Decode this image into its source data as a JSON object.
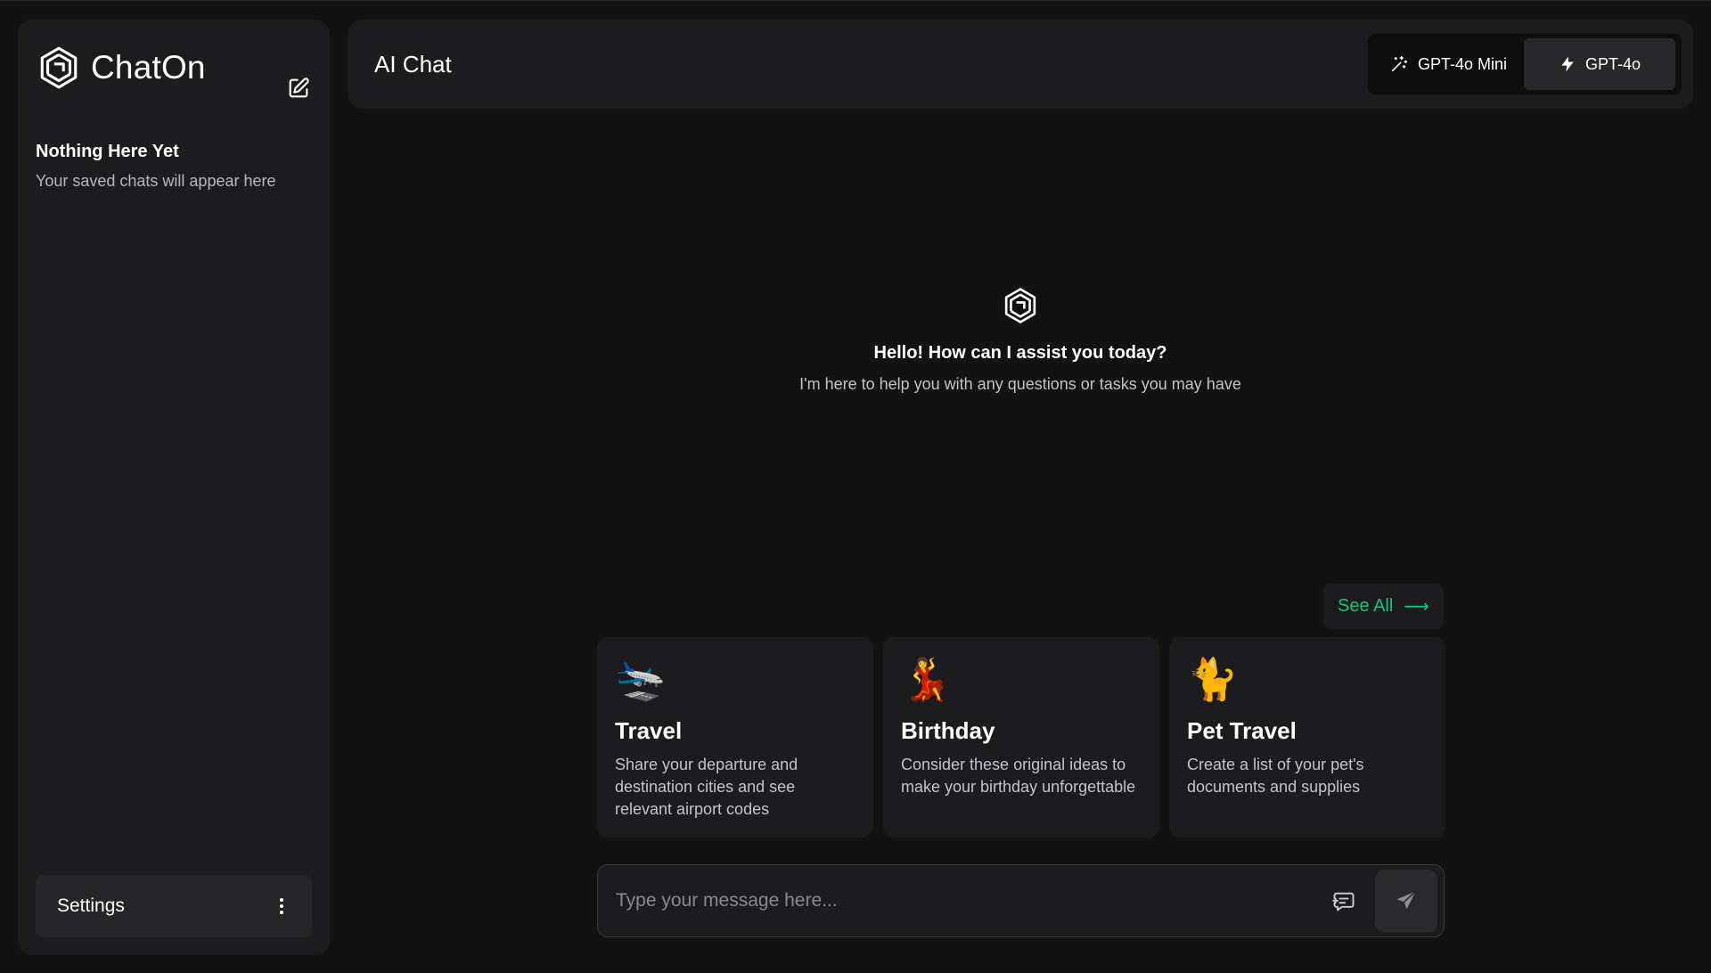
{
  "sidebar": {
    "brand": "ChatOn",
    "empty_title": "Nothing Here Yet",
    "empty_subtitle": "Your saved chats will appear here",
    "settings_label": "Settings"
  },
  "header": {
    "title": "AI Chat",
    "models": [
      {
        "label": "GPT-4o Mini",
        "icon": "magic-wand-icon",
        "selected": false
      },
      {
        "label": "GPT-4o",
        "icon": "lightning-bolt-icon",
        "selected": true
      }
    ]
  },
  "greeting": {
    "title": "Hello! How can I assist you today?",
    "subtitle": "I'm here to help you with any questions or tasks you may have"
  },
  "suggestions": {
    "see_all_label": "See All",
    "see_all_arrow": "⟶",
    "cards": [
      {
        "emoji": "🛬",
        "title": "Travel",
        "description": "Share your departure and destination cities and see relevant airport codes"
      },
      {
        "emoji": "💃",
        "title": "Birthday",
        "description": "Consider these original ideas to make your birthday unforgettable"
      },
      {
        "emoji": "🐈",
        "title": "Pet Travel",
        "description": "Create a list of your pet's documents and supplies"
      }
    ]
  },
  "composer": {
    "placeholder": "Type your message here...",
    "value": ""
  },
  "colors": {
    "accent": "#19c37d",
    "background": "#121213",
    "panel": "#1c1c1e"
  }
}
